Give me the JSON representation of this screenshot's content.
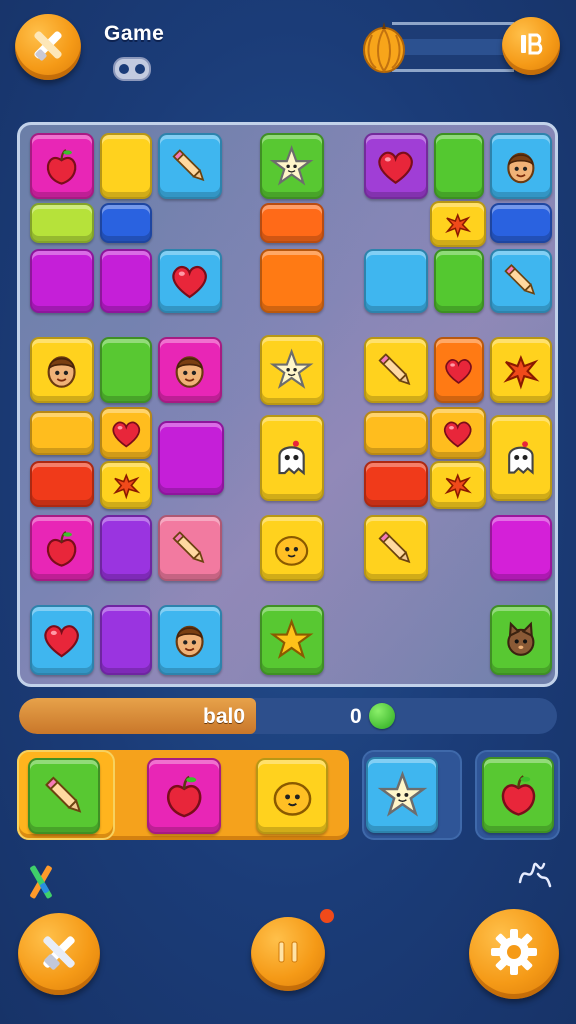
{
  "header": {
    "title": "Game",
    "left_button_icon": "crossed-tools-icon",
    "subtitle_icon": "gamepad-icon",
    "currency_icon": "seed-icon",
    "right_button_icon": "info-icon"
  },
  "progress": {
    "label": "bal0",
    "value": "0",
    "fill_fraction": 0.44
  },
  "bottom_nav": {
    "left_button_icon": "crossed-tools-icon",
    "center_button_icon": "pause-icon",
    "right_button_icon": "gear-icon"
  },
  "colors": {
    "background": "#1b3c78",
    "button_orange": "#f59a17",
    "board": "#7a84b4",
    "tray": "#f5a21c"
  },
  "tiles": [
    {
      "color": "#e826b6",
      "icon": "apple-icon"
    },
    {
      "color": "#ffd21e",
      "icon": ""
    },
    {
      "color": "#3fb6ef",
      "icon": "pencil-icon"
    },
    {
      "color": "#58c832",
      "icon": "star-face-icon"
    },
    {
      "color": "#a03ed6",
      "icon": "heart-icon"
    },
    {
      "color": "#54c830",
      "icon": ""
    },
    {
      "color": "#3fb6ef",
      "icon": "face-icon"
    },
    {
      "color": "#b6e23a",
      "icon": ""
    },
    {
      "color": "#2a62e0",
      "icon": ""
    },
    {
      "color": "#ff6a18",
      "icon": ""
    },
    {
      "color": "#ffd21e",
      "icon": "splat-icon"
    },
    {
      "color": "#2a62e0",
      "icon": ""
    },
    {
      "color": "#c51fd8",
      "icon": ""
    },
    {
      "color": "#c51fd8",
      "icon": ""
    },
    {
      "color": "#3fb6ef",
      "icon": "heart-icon"
    },
    {
      "color": "#ff7a14",
      "icon": ""
    },
    {
      "color": "#3fb6ef",
      "icon": ""
    },
    {
      "color": "#54c830",
      "icon": ""
    },
    {
      "color": "#3fb6ef",
      "icon": "pencil-icon"
    },
    {
      "color": "#ffd21e",
      "icon": "face-icon"
    },
    {
      "color": "#58c832",
      "icon": ""
    },
    {
      "color": "#e826b6",
      "icon": "face-icon"
    },
    {
      "color": "#ffd21e",
      "icon": "star-face-icon"
    },
    {
      "color": "#ffd21e",
      "icon": "pencil-icon"
    },
    {
      "color": "#ff7a14",
      "icon": "heart-icon"
    },
    {
      "color": "#ffd21e",
      "icon": "splat-icon"
    },
    {
      "color": "#ffbd1e",
      "icon": ""
    },
    {
      "color": "#ffbd1e",
      "icon": "heart-icon"
    },
    {
      "color": "#c51fd8",
      "icon": ""
    },
    {
      "color": "#ffd21e",
      "icon": "ghost-icon"
    },
    {
      "color": "#ffbd1e",
      "icon": ""
    },
    {
      "color": "#ffbd1e",
      "icon": "heart-icon"
    },
    {
      "color": "#ffd21e",
      "icon": "ghost-icon"
    },
    {
      "color": "#f03a1a",
      "icon": ""
    },
    {
      "color": "#ffd21e",
      "icon": "splat-icon"
    },
    {
      "color": "#f03a1a",
      "icon": ""
    },
    {
      "color": "#ffd21e",
      "icon": "splat-icon"
    },
    {
      "color": "#e826b6",
      "icon": "apple-icon"
    },
    {
      "color": "#9a34e0",
      "icon": ""
    },
    {
      "color": "#f27aa0",
      "icon": "pencil-icon"
    },
    {
      "color": "#ffd21e",
      "icon": "blob-icon"
    },
    {
      "color": "#ffd21e",
      "icon": "pencil-icon"
    },
    {
      "color": "#d420d8",
      "icon": ""
    },
    {
      "color": "#3fb6ef",
      "icon": "heart-icon"
    },
    {
      "color": "#9a34e0",
      "icon": ""
    },
    {
      "color": "#3fb6ef",
      "icon": "face-icon"
    },
    {
      "color": "#58c832",
      "icon": "star-icon"
    },
    {
      "color": "#58c832",
      "icon": "cat-icon"
    }
  ],
  "tray": {
    "tiles": [
      {
        "color": "#58c832",
        "icon": "pencil-icon"
      },
      {
        "color": "#e826b6",
        "icon": "apple-icon"
      },
      {
        "color": "#ffd21e",
        "icon": "blob-icon"
      }
    ],
    "slots": [
      {
        "color": "#3fb6ef",
        "icon": "star-face-icon"
      },
      {
        "color": "#58c832",
        "icon": "apple-icon"
      }
    ]
  },
  "decorations": {
    "left_icon": "crossed-pencils-icon",
    "right_icon": "scribble-icon"
  }
}
